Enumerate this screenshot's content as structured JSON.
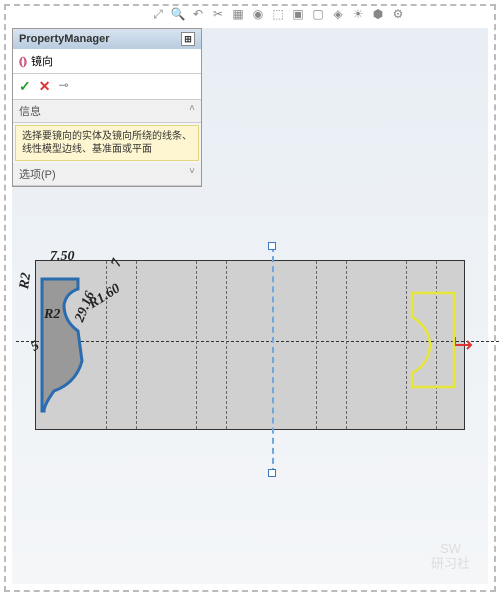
{
  "panel": {
    "title": "PropertyManager",
    "feature_icon": "⦅⦆",
    "feature_name": "镜向",
    "ok": "✓",
    "cancel": "✕",
    "pin": "⊸",
    "info_header": "信息",
    "info_text": "选择要镜向的实体及镜向所绕的线条、线性模型边线、基准面或平面",
    "options_header": "选项(P)"
  },
  "dimensions": {
    "d1": "7.50",
    "d2": "7",
    "d3": "R1.60",
    "d4": "R2",
    "d5": "29.16",
    "d6": "5",
    "d7": "R2"
  },
  "watermark": {
    "l1": "SW",
    "l2": "研习社"
  }
}
